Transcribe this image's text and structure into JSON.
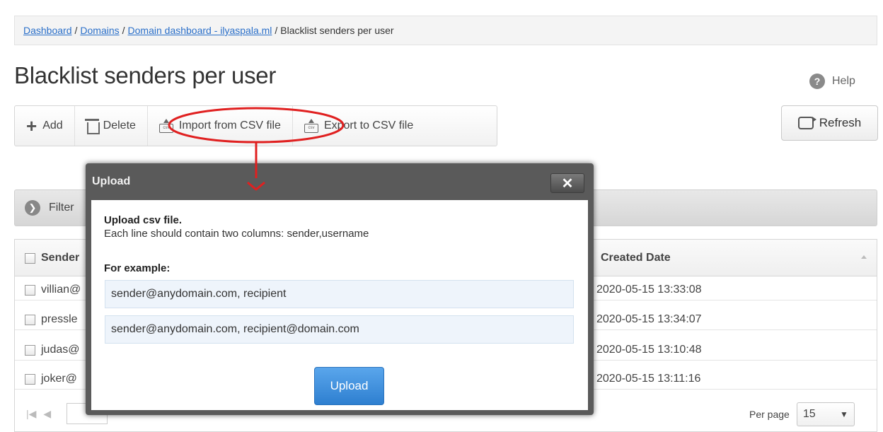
{
  "breadcrumb": {
    "items": [
      "Dashboard",
      "Domains",
      "Domain dashboard - ilyaspala.ml"
    ],
    "current": "Blacklist senders per user",
    "separator": "/"
  },
  "page": {
    "title": "Blacklist senders per user",
    "help_label": "Help"
  },
  "toolbar": {
    "add_label": "Add",
    "delete_label": "Delete",
    "import_label": "Import from CSV file",
    "export_label": "Export to CSV file",
    "refresh_label": "Refresh"
  },
  "filter": {
    "label": "Filter"
  },
  "grid": {
    "columns": [
      "Sender",
      "Created Date"
    ],
    "rows": [
      {
        "sender": "villian@",
        "created": "2020-05-15 13:33:08"
      },
      {
        "sender": "pressle",
        "created": "2020-05-15 13:34:07"
      },
      {
        "sender": "judas@",
        "created": "2020-05-15 13:10:48"
      },
      {
        "sender": "joker@",
        "created": "2020-05-15 13:11:16"
      }
    ]
  },
  "pagination": {
    "per_page_label": "Per page",
    "per_page_value": "15"
  },
  "modal": {
    "title": "Upload",
    "close_glyph": "✕",
    "heading": "Upload csv file.",
    "description": "Each line should contain two columns: sender,username",
    "example_heading": "For example:",
    "examples": [
      "sender@anydomain.com, recipient",
      "sender@anydomain.com, recipient@domain.com"
    ],
    "upload_label": "Upload"
  },
  "colors": {
    "annotation": "#e02020",
    "link": "#2a6fc9",
    "primary_button": "#3b8ddc"
  }
}
